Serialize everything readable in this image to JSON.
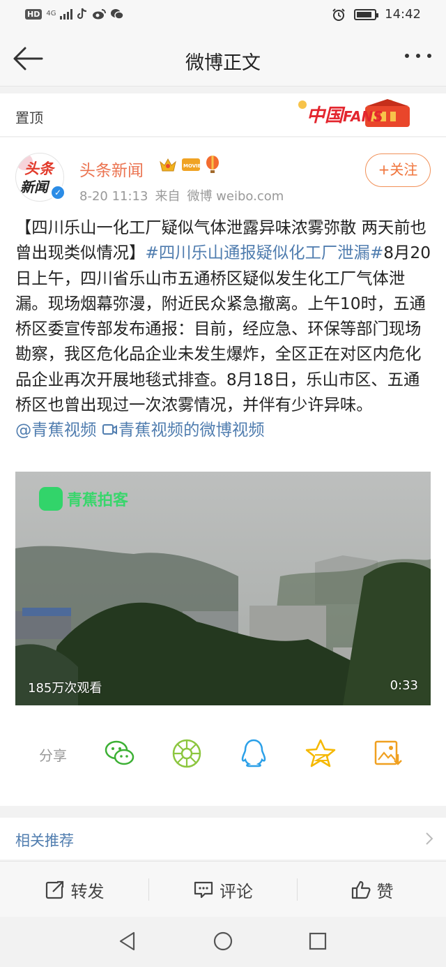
{
  "status_bar": {
    "left_indicators": [
      "HD",
      "4G"
    ],
    "apps": [
      "tiktok-icon",
      "weibo-icon",
      "wechat-icon"
    ],
    "time": "14:42"
  },
  "nav": {
    "title": "微博正文",
    "back_icon": "back-arrow-icon",
    "more_icon": "more-icon"
  },
  "pinned": {
    "label": "置顶",
    "banner_text": "中国FANS"
  },
  "post": {
    "avatar": {
      "line1": "头条",
      "line2": "新闻"
    },
    "username": "头条新闻",
    "time": "8-20 11:13",
    "source_prefix": "来自",
    "source": "微博 weibo.com",
    "follow_label": "+关注",
    "text_title": "【四川乐山一化工厂疑似气体泄露异味浓雾弥散 两天前也曾出现类似情况】",
    "topic": "#四川乐山通报疑似化工厂泄漏#",
    "body": "8月20日上午，四川省乐山市五通桥区疑似发生化工厂气体泄漏。现场烟幕弥漫，附近民众紧急撤离。上午10时，五通桥区委宣传部发布通报：目前，经应急、环保等部门现场勘察，我区危化品企业未发生爆炸，全区正在对区内危化品企业再次开展地毯式排查。8月18日，乐山市区、五通桥区也曾出现过一次浓雾情况，并伴有少许异味。",
    "mention": "@青蕉视频",
    "video_link": "青蕉视频的微博视频",
    "video": {
      "watermark": "青蕉拍客",
      "views": "185万次观看",
      "duration": "0:33"
    }
  },
  "share": {
    "label": "分享",
    "icons": [
      "wechat-share-icon",
      "moments-share-icon",
      "qq-share-icon",
      "qzone-share-icon",
      "save-image-icon"
    ]
  },
  "related": {
    "label": "相关推荐"
  },
  "actions": {
    "repost": "转发",
    "comment": "评论",
    "like": "赞"
  },
  "colors": {
    "accent": "#eb7350",
    "link": "#507daf",
    "wechat_green": "#3cb034",
    "moments_green": "#8cc63f",
    "qq_blue": "#2ba0e8",
    "star_yellow": "#f5b800",
    "save_orange": "#f0a020"
  }
}
